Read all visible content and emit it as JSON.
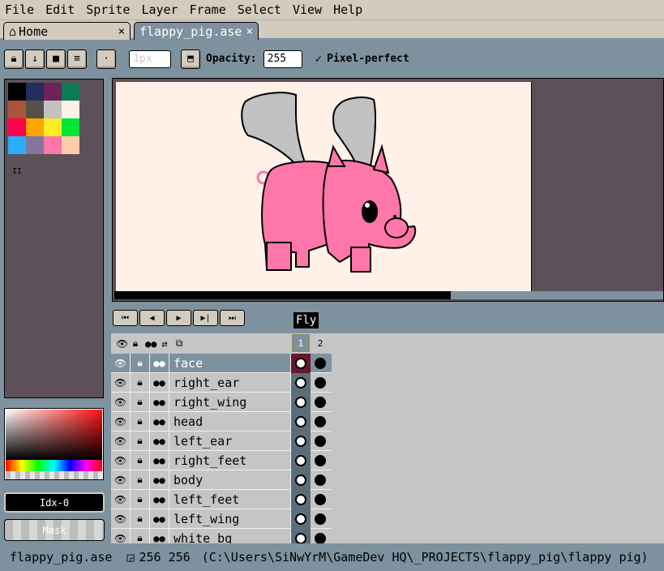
{
  "menu": [
    "File",
    "Edit",
    "Sprite",
    "Layer",
    "Frame",
    "Select",
    "View",
    "Help"
  ],
  "tabs": {
    "home": {
      "label": "Home",
      "close": "×"
    },
    "file": {
      "label": "flappy_pig.ase",
      "close": "×"
    }
  },
  "toolbar": {
    "brush_size_placeholder": "1px",
    "opacity_label": "Opacity:",
    "opacity_value": "255",
    "pixel_perfect_label": "Pixel-perfect",
    "pixel_perfect_checked": "✓"
  },
  "palette": {
    "colors": [
      "#000000",
      "#222f5c",
      "#6e2257",
      "#0a7a57",
      "#a8553c",
      "#55504a",
      "#c2c2c2",
      "#fff1e8",
      "#ff004d",
      "#ffa300",
      "#ffec27",
      "#00e436",
      "#29adff",
      "#83769c",
      "#ff77a8",
      "#ffccaa"
    ],
    "more_indicator": "II"
  },
  "color_bar": {
    "index_label": "Idx-0",
    "mask_label": "Mask"
  },
  "timeline": {
    "tag_name": "Fly",
    "frame_numbers": [
      "1",
      "2"
    ],
    "layers": [
      {
        "name": "face",
        "active": true
      },
      {
        "name": "right_ear",
        "active": false
      },
      {
        "name": "right_wing",
        "active": false
      },
      {
        "name": "head",
        "active": false
      },
      {
        "name": "left_ear",
        "active": false
      },
      {
        "name": "right_feet",
        "active": false
      },
      {
        "name": "body",
        "active": false
      },
      {
        "name": "left_feet",
        "active": false
      },
      {
        "name": "left_wing",
        "active": false
      },
      {
        "name": "white_bg",
        "active": false
      }
    ]
  },
  "status": {
    "filename": "flappy_pig.ase",
    "dimensions": "256 256",
    "path": "(C:\\Users\\SiNwYrM\\GameDev HQ\\_PROJECTS\\flappy_pig\\flappy pig)"
  },
  "colors": {
    "accent": "#7d929e",
    "pig_pink": "#ff77a8",
    "wing_gray": "#c2c2c2"
  }
}
